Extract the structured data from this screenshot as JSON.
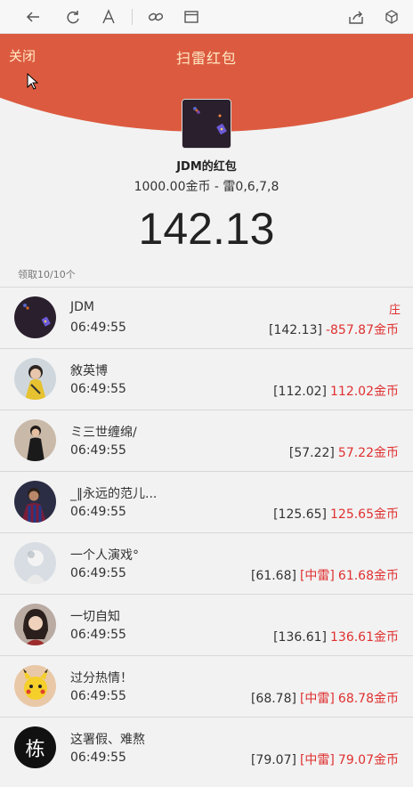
{
  "toolbar": {
    "icons": [
      "back-icon",
      "refresh-icon",
      "font-icon",
      "link-icon",
      "window-icon",
      "share-icon",
      "cube-icon"
    ]
  },
  "header": {
    "close_label": "关闭",
    "title": "扫雷红包",
    "color": "#dc5b40"
  },
  "sender": {
    "name": "JDM的红包",
    "info": "1000.00金币 - 雷0,6,7,8",
    "amount": "142.13"
  },
  "received_label": "领取10/10个",
  "rows": [
    {
      "name": "JDM",
      "time": "06:49:55",
      "grab": "[142.13]",
      "mine": "",
      "result": "-857.87金币",
      "badge": "庄"
    },
    {
      "name": "敘英博",
      "time": "06:49:55",
      "grab": "[112.02]",
      "mine": "",
      "result": "112.02金币",
      "badge": ""
    },
    {
      "name": "ミ三世缠绵/",
      "time": "06:49:55",
      "grab": "[57.22]",
      "mine": "",
      "result": "57.22金币",
      "badge": ""
    },
    {
      "name": "_‖永远的范儿...",
      "time": "06:49:55",
      "grab": "[125.65]",
      "mine": "",
      "result": "125.65金币",
      "badge": ""
    },
    {
      "name": "一个人演戏°",
      "time": "06:49:55",
      "grab": "[61.68]",
      "mine": "[中雷]",
      "result": "61.68金币",
      "badge": ""
    },
    {
      "name": "一切自知",
      "time": "06:49:55",
      "grab": "[136.61]",
      "mine": "",
      "result": "136.61金币",
      "badge": ""
    },
    {
      "name": "过分热情！",
      "time": "06:49:55",
      "grab": "[68.78]",
      "mine": "[中雷]",
      "result": "68.78金币",
      "badge": ""
    },
    {
      "name": "这署假、难熬",
      "time": "06:49:55",
      "grab": "[79.07]",
      "mine": "[中雷]",
      "result": "79.07金币",
      "badge": ""
    }
  ],
  "last_avatar_glyph": "栋"
}
